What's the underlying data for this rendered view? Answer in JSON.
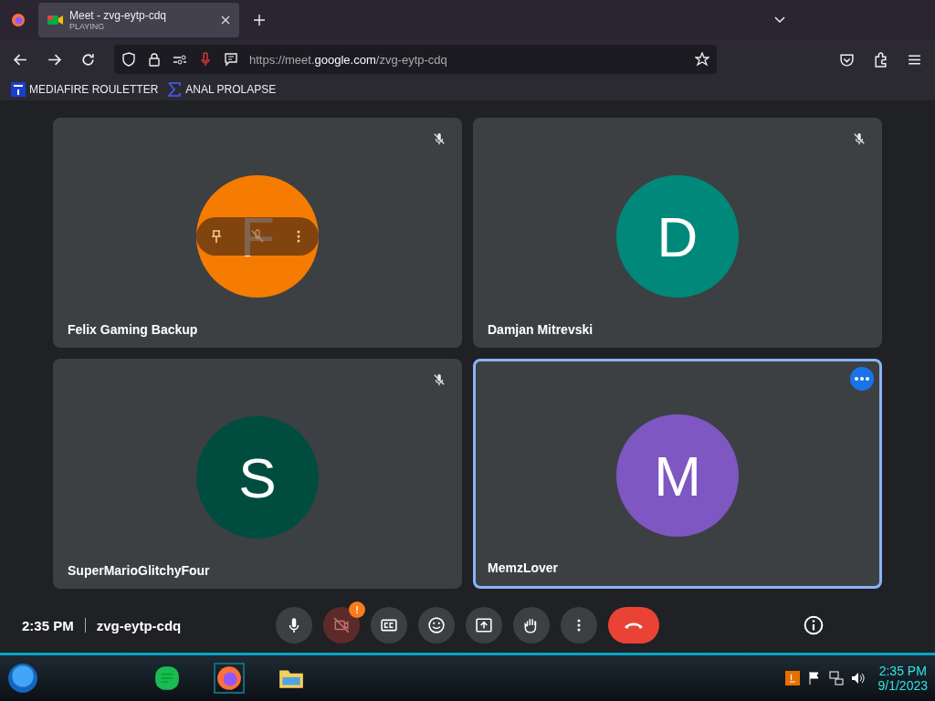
{
  "browser": {
    "tab": {
      "title": "Meet - zvg-eytp-cdq",
      "status": "PLAYING",
      "selected": true
    },
    "url": {
      "prefix": "https://meet.",
      "domain": "google.com",
      "path": "/zvg-eytp-cdq"
    },
    "bookmarks": [
      {
        "label": "MEDIAFIRE ROULETTER",
        "kind": "mft"
      },
      {
        "label": "ANAL PROLAPSE",
        "kind": "sigma"
      }
    ]
  },
  "tiles": [
    {
      "name": "Felix Gaming Backup",
      "initial": "F",
      "color": "#f57c00",
      "muted": true,
      "hovered": true,
      "selected": false
    },
    {
      "name": "Damjan Mitrevski",
      "initial": "D",
      "color": "#00897b",
      "muted": true,
      "hovered": false,
      "selected": false
    },
    {
      "name": "SuperMarioGlitchyFour",
      "initial": "S",
      "color": "#004d40",
      "muted": true,
      "hovered": false,
      "selected": false
    },
    {
      "name": "MemzLover",
      "initial": "M",
      "color": "#7e57c2",
      "muted": false,
      "hovered": false,
      "selected": true
    }
  ],
  "meeting": {
    "time": "2:35 PM",
    "code": "zvg-eytp-cdq"
  },
  "controls": [
    {
      "kind": "mic"
    },
    {
      "kind": "camera-off",
      "alert": "!"
    },
    {
      "kind": "captions"
    },
    {
      "kind": "emoji"
    },
    {
      "kind": "present"
    },
    {
      "kind": "hand"
    },
    {
      "kind": "more"
    },
    {
      "kind": "leave"
    }
  ],
  "taskbar": {
    "time": "2:35 PM",
    "date": "9/1/2023"
  }
}
